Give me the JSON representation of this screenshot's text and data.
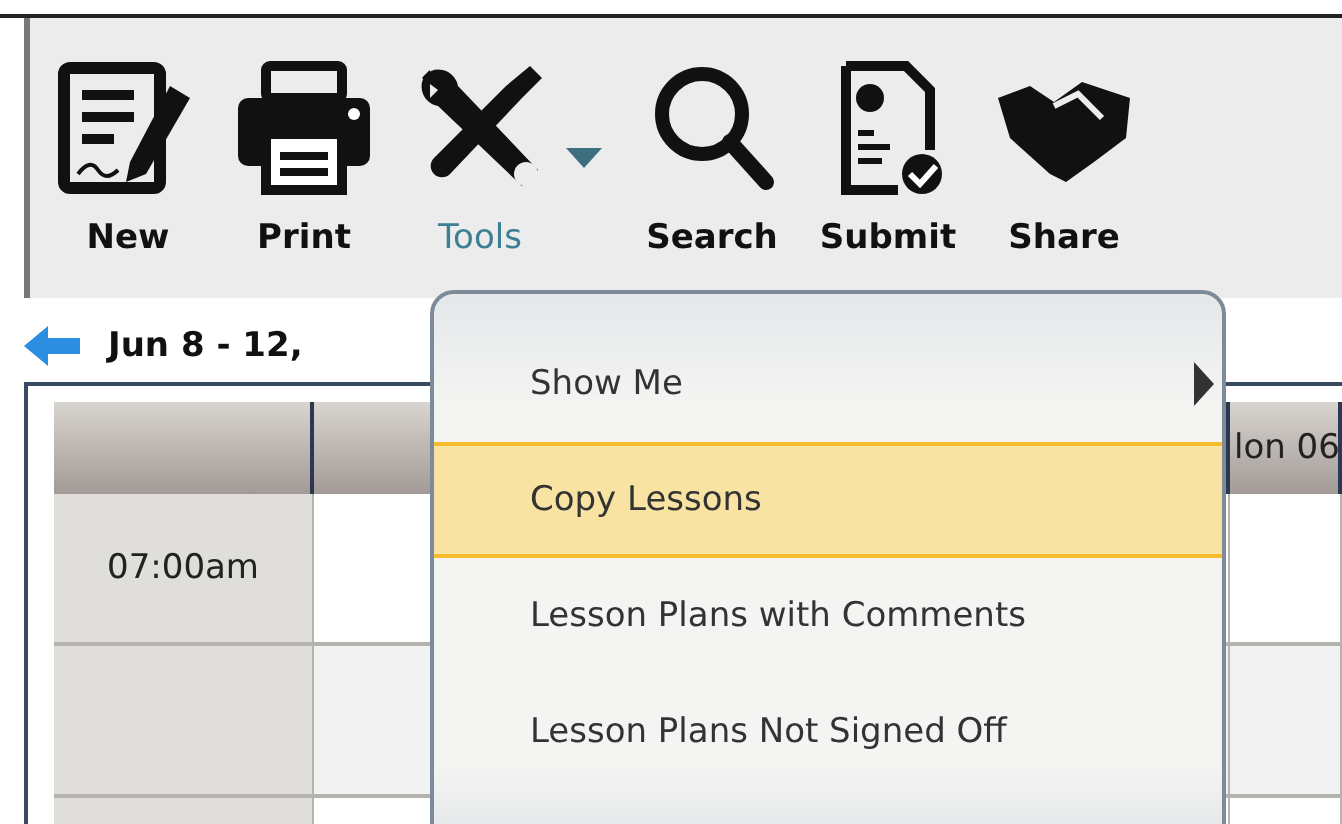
{
  "toolbar": {
    "buttons": [
      {
        "label": "New",
        "kind": "new",
        "dropdown": false,
        "selected": false
      },
      {
        "label": "Print",
        "kind": "print",
        "dropdown": false,
        "selected": false
      },
      {
        "label": "Tools",
        "kind": "tools",
        "dropdown": true,
        "selected": true
      },
      {
        "label": "Search",
        "kind": "search",
        "dropdown": false,
        "selected": false
      },
      {
        "label": "Submit",
        "kind": "submit",
        "dropdown": false,
        "selected": false
      },
      {
        "label": "Share",
        "kind": "share",
        "dropdown": false,
        "selected": false
      }
    ]
  },
  "week": {
    "title": "Jun 8 - 12,"
  },
  "calendar": {
    "columns": [
      "",
      "",
      "lon 06"
    ],
    "rows": [
      {
        "time": "07:00am"
      },
      {
        "time": ""
      },
      {
        "time": ""
      }
    ]
  },
  "menu": {
    "items": [
      {
        "label": "Show Me",
        "submenu": true,
        "selected": false
      },
      {
        "label": "Copy Lessons",
        "submenu": false,
        "selected": true
      },
      {
        "label": "Lesson Plans with Comments",
        "submenu": false,
        "selected": false
      },
      {
        "label": "Lesson Plans Not Signed Off",
        "submenu": false,
        "selected": false
      }
    ]
  }
}
